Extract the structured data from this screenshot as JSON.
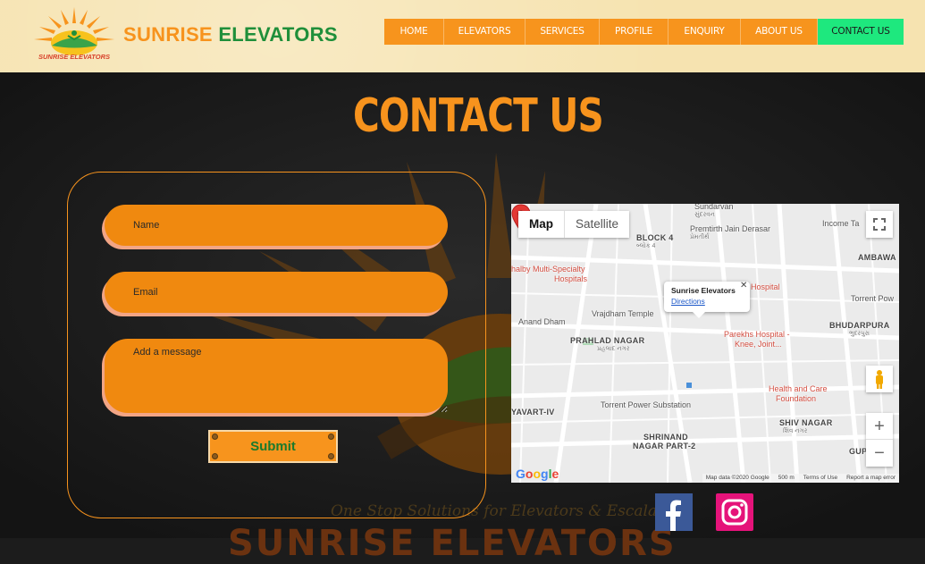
{
  "header": {
    "logo_text": "SUNRISE ELEVATORS",
    "logo_tagline": "One Stop Solutions for Elevators & Escalators",
    "brand_word1": "SUNRISE",
    "brand_word2": "ELEVATORS"
  },
  "nav": {
    "items": [
      {
        "label": "HOME"
      },
      {
        "label": "ELEVATORS"
      },
      {
        "label": "SERVICES"
      },
      {
        "label": "PROFILE"
      },
      {
        "label": "ENQUIRY"
      },
      {
        "label": "ABOUT US"
      },
      {
        "label": "CONTACT US",
        "active": true
      }
    ]
  },
  "page": {
    "title": "CONTACT US"
  },
  "form": {
    "name_placeholder": "Name",
    "email_placeholder": "Email",
    "message_placeholder": "Add a message",
    "submit_label": "Submit"
  },
  "map": {
    "tab_map": "Map",
    "tab_satellite": "Satellite",
    "info_title": "Sunrise Elevators",
    "info_link": "Directions",
    "labels": [
      {
        "text": "Sundarvan",
        "style": ""
      },
      {
        "text": "સુંદરવન",
        "style": "gu"
      },
      {
        "text": "Premtirth Jain Derasar",
        "style": ""
      },
      {
        "text": "પ્રેમતીર્થ",
        "style": "gu"
      },
      {
        "text": "BLOCK 4",
        "style": "bold"
      },
      {
        "text": "બ્લોક 4",
        "style": "gu"
      },
      {
        "text": "Income Ta",
        "style": ""
      },
      {
        "text": "AMBAWA",
        "style": "bold"
      },
      {
        "text": "halby Multi-Specialty",
        "style": "red"
      },
      {
        "text": "Hospitals",
        "style": "red"
      },
      {
        "text": "Torrent Pow",
        "style": ""
      },
      {
        "text": "Hospital",
        "style": "red"
      },
      {
        "text": "BHUDARPURA",
        "style": "bold"
      },
      {
        "text": "ભુદરપુરા",
        "style": "gu"
      },
      {
        "text": "Anand Dham",
        "style": ""
      },
      {
        "text": "Vrajdham Temple",
        "style": ""
      },
      {
        "text": "PRAHLAD NAGAR",
        "style": "bold"
      },
      {
        "text": "પ્રહલાદ નગર",
        "style": "gu"
      },
      {
        "text": "Parekhs Hospital -",
        "style": "red"
      },
      {
        "text": "Knee, Joint...",
        "style": "red"
      },
      {
        "text": "Health and Care",
        "style": "red"
      },
      {
        "text": "Foundation",
        "style": "red"
      },
      {
        "text": "Torrent Power Substation",
        "style": ""
      },
      {
        "text": "YAVART-IV",
        "style": "bold"
      },
      {
        "text": "SHIV NAGAR",
        "style": "bold"
      },
      {
        "text": "શિવ નગર",
        "style": "gu"
      },
      {
        "text": "SHRINAND",
        "style": "bold"
      },
      {
        "text": "NAGAR PART-2",
        "style": "bold"
      },
      {
        "text": "GUPTA NA",
        "style": "bold"
      }
    ],
    "attribution": "Map data ©2020 Google",
    "scale": "500 m",
    "terms": "Terms of Use",
    "report": "Report a map error",
    "google": "Google"
  },
  "footer": {
    "tagline": "One Stop Solutions for Elevators & Escalators",
    "big_brand": "SUNRISE ELEVATORS"
  },
  "colors": {
    "accent": "#f7931d",
    "brand_green": "#1f8f3a",
    "nav_active": "#1ee87e",
    "field_fill": "#f0890f"
  }
}
